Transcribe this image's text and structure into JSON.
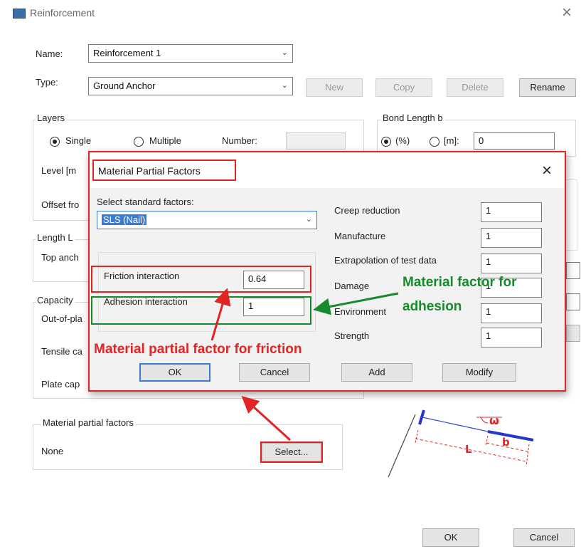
{
  "window": {
    "title": "Reinforcement",
    "close_glyph": "×"
  },
  "main": {
    "name_label": "Name:",
    "name_value": "Reinforcement 1",
    "type_label": "Type:",
    "type_value": "Ground Anchor",
    "buttons": {
      "new": "New",
      "copy": "Copy",
      "delete": "Delete",
      "rename": "Rename"
    },
    "layers": {
      "title": "Layers",
      "single": "Single",
      "multiple": "Multiple",
      "number_label": "Number:",
      "level_label": "Level [m",
      "offset_label": "Offset fro"
    },
    "bond_length": {
      "title": "Bond Length b",
      "pct": "(%)",
      "m": "[m]:",
      "value": "0"
    },
    "length": {
      "title": "Length L",
      "top_anchor": "Top anch"
    },
    "capacity": {
      "title": "Capacity",
      "out_of_plane": "Out-of-pla",
      "tensile": "Tensile ca",
      "plate": "Plate cap"
    },
    "material": {
      "title": "Material partial factors",
      "value": "None",
      "select_button": "Select..."
    },
    "ok": "OK",
    "cancel": "Cancel"
  },
  "dialog": {
    "title": "Material Partial Factors",
    "close_glyph": "×",
    "select_label": "Select standard factors:",
    "select_value": "SLS (Nail)",
    "friction_label": "Friction interaction",
    "friction_value": "0.64",
    "adhesion_label": "Adhesion interaction",
    "adhesion_value": "1",
    "factors": [
      {
        "label": "Creep reduction",
        "value": "1"
      },
      {
        "label": "Manufacture",
        "value": "1"
      },
      {
        "label": "Extrapolation of test data",
        "value": "1"
      },
      {
        "label": "Damage",
        "value": "1"
      },
      {
        "label": "Environment",
        "value": "1"
      },
      {
        "label": "Strength",
        "value": "1"
      }
    ],
    "buttons": {
      "ok": "OK",
      "cancel": "Cancel",
      "add": "Add",
      "modify": "Modify"
    }
  },
  "annotations": {
    "friction": "Material partial factor for friction",
    "adhesion_line1": "Material factor for",
    "adhesion_line2": "adhesion",
    "red_color": "#e12424",
    "green_color": "#178a2e"
  },
  "diagram": {
    "omega": "ω",
    "L": "L",
    "b": "b"
  }
}
